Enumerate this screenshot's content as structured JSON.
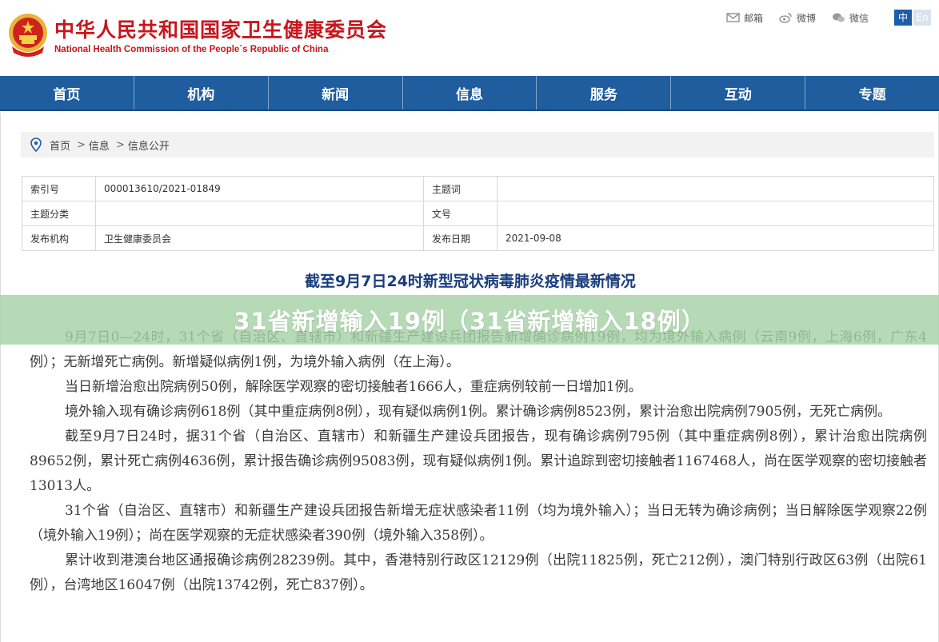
{
  "header": {
    "org_cn": "中华人民共和国国家卫生健康委员会",
    "org_en": "National Health Commission of the People´s Republic of China",
    "links": [
      {
        "icon": "mail-icon",
        "label": "邮箱"
      },
      {
        "icon": "weibo-icon",
        "label": "微博"
      },
      {
        "icon": "wechat-icon",
        "label": "微信"
      }
    ],
    "lang": {
      "zh": "中",
      "en": "En"
    }
  },
  "nav": [
    "首页",
    "机构",
    "新闻",
    "信息",
    "服务",
    "互动",
    "专题"
  ],
  "breadcrumb": {
    "home": "首页",
    "items": [
      "信息",
      "信息公开"
    ],
    "separator": ">"
  },
  "meta": {
    "index_no_label": "索引号",
    "index_no": "000013610/2021-01849",
    "keyword_label": "主题词",
    "keyword": "",
    "category_label": "主题分类",
    "category": "",
    "doc_no_label": "文号",
    "doc_no": "",
    "issuer_label": "发布机构",
    "issuer": "卫生健康委员会",
    "date_label": "发布日期",
    "date": "2021-09-08"
  },
  "article": {
    "title": "截至9月7日24时新型冠状病毒肺炎疫情最新情况",
    "paragraphs": [
      "9月7日0—24时，31个省（自治区、直辖市）和新疆生产建设兵团报告新增确诊病例19例，均为境外输入病例（云南9例，上海6例，广东4例）；无新增死亡病例。新增疑似病例1例，为境外输入病例（在上海）。",
      "当日新增治愈出院病例50例，解除医学观察的密切接触者1666人，重症病例较前一日增加1例。",
      "境外输入现有确诊病例618例（其中重症病例8例），现有疑似病例1例。累计确诊病例8523例，累计治愈出院病例7905例，无死亡病例。",
      "截至9月7日24时，据31个省（自治区、直辖市）和新疆生产建设兵团报告，现有确诊病例795例（其中重症病例8例），累计治愈出院病例89652例，累计死亡病例4636例，累计报告确诊病例95083例，现有疑似病例1例。累计追踪到密切接触者1167468人，尚在医学观察的密切接触者13013人。",
      "31个省（自治区、直辖市）和新疆生产建设兵团报告新增无症状感染者11例（均为境外输入）；当日无转为确诊病例；当日解除医学观察22例（境外输入19例）；尚在医学观察的无症状感染者390例（境外输入358例）。",
      "累计收到港澳台地区通报确诊病例28239例。其中，香港特别行政区12129例（出院11825例，死亡212例），澳门特别行政区63例（出院61例），台湾地区16047例（出院13742例，死亡837例）。"
    ]
  },
  "banner": {
    "text": "31省新增输入19例（31省新增输入18例）"
  },
  "colors": {
    "brand_red": "#c8161d",
    "nav_blue": "#1f5d9e",
    "title_blue": "#1a3d7c",
    "banner_green": "#a6d2a6"
  }
}
